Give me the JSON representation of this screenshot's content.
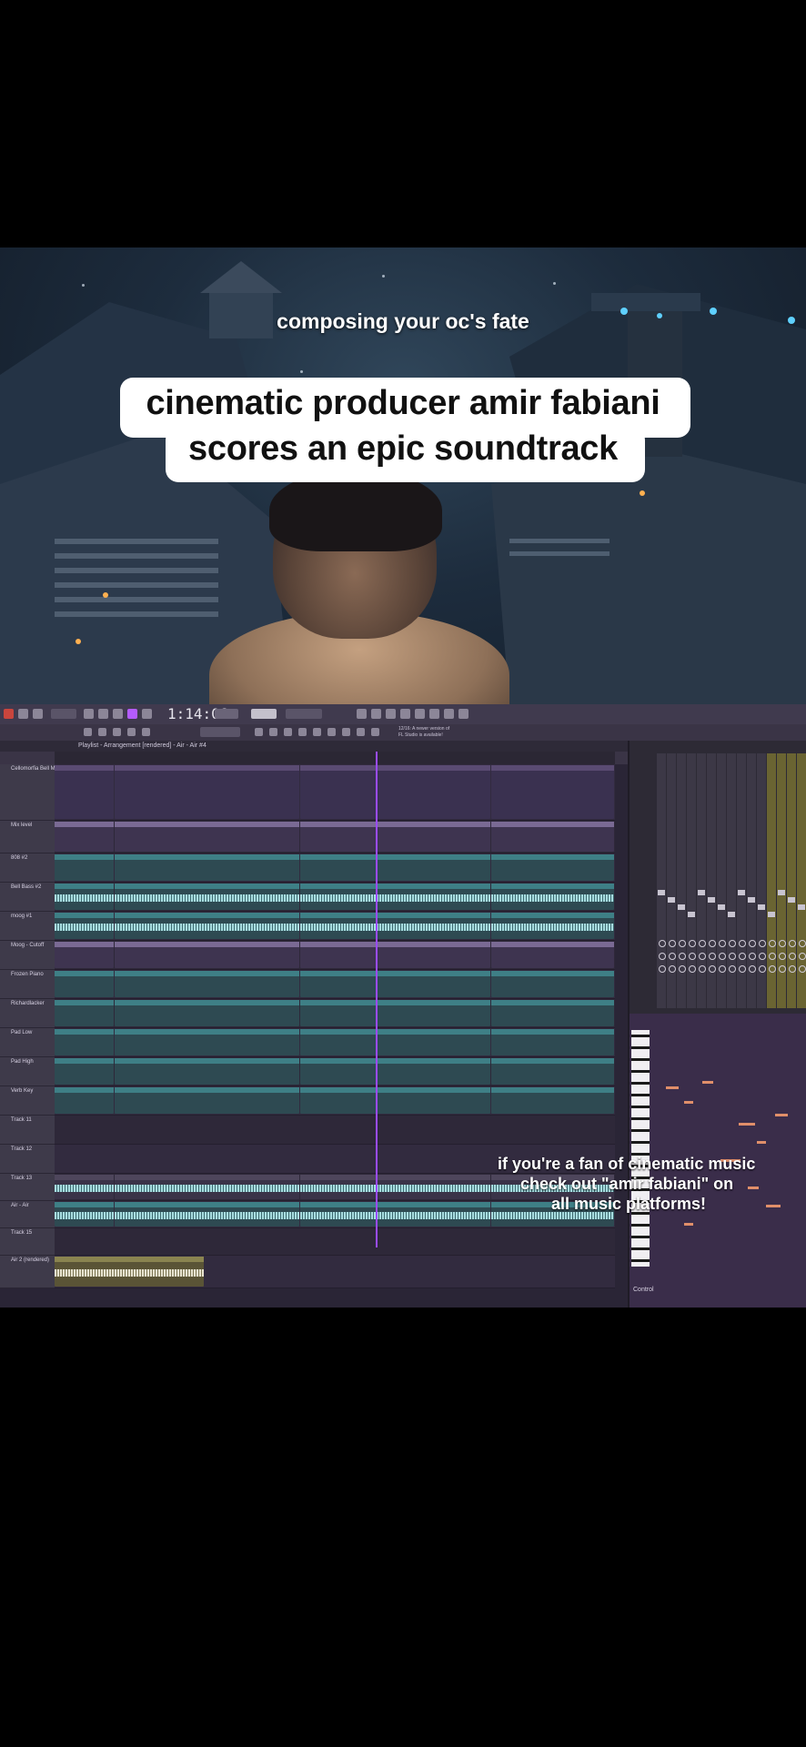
{
  "overlay": {
    "top_caption": "composing your oc's fate",
    "title_line1": "cinematic producer amir fabiani",
    "title_line2": "scores an epic soundtrack",
    "bottom_caption_line1": "if you're a fan of cinematic music",
    "bottom_caption_line2": "check out \"amir fabiani\" on",
    "bottom_caption_line3": "all music platforms!"
  },
  "daw": {
    "time": "1:14:08",
    "playlist_title": "Playlist - Arrangement [rendered] - Air - Air #4",
    "hint_line1": "12/16: A newer version of",
    "hint_line2": "FL Studio is available!",
    "tracks": [
      {
        "label": "Cellomorfia Bell Melody"
      },
      {
        "label": "Mix level"
      },
      {
        "label": "808 #2"
      },
      {
        "label": "Bell Bass #2"
      },
      {
        "label": "moog #1"
      },
      {
        "label": "Moog - Cutoff"
      },
      {
        "label": "Frozen Piano"
      },
      {
        "label": "Richardlacker"
      },
      {
        "label": "Pad Low"
      },
      {
        "label": "Pad High"
      },
      {
        "label": "Verb Key"
      },
      {
        "label": "Track 11"
      },
      {
        "label": "Track 12"
      },
      {
        "label": "Track 13"
      },
      {
        "label": "Air - Air"
      },
      {
        "label": "Track 15"
      },
      {
        "label": "Air 2 (rendered)"
      }
    ],
    "piano_roll_label": "Control"
  },
  "colors": {
    "accent": "#9a4cff",
    "teal_clip": "#3e7f86",
    "purple_clip": "#5a3d7a",
    "note": "#e08f6a"
  }
}
